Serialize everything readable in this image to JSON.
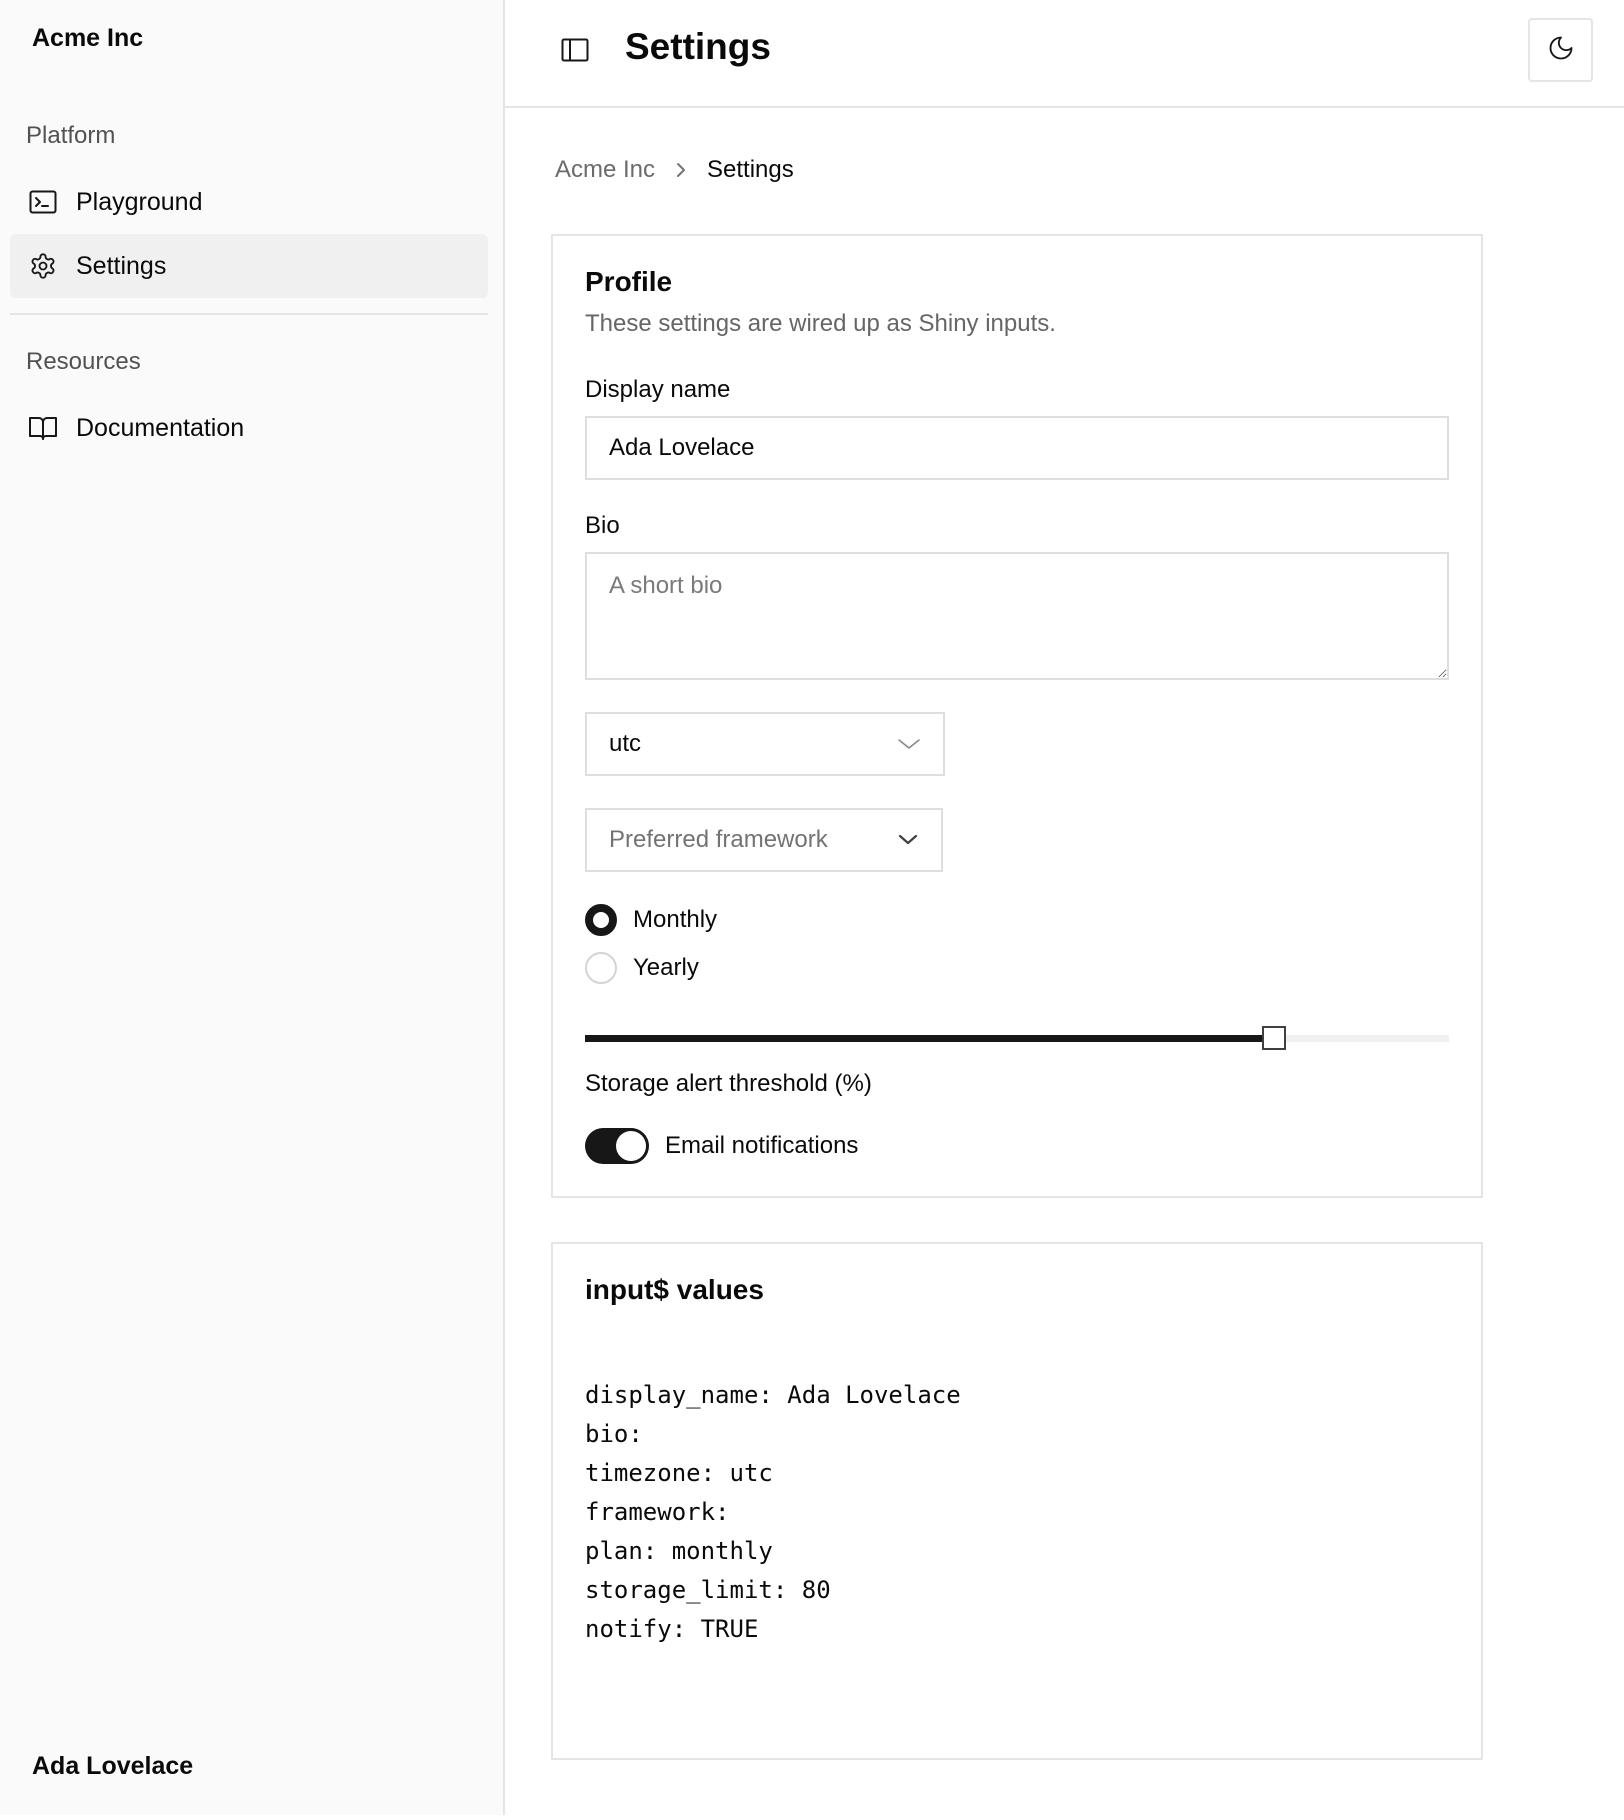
{
  "sidebar": {
    "brand": "Acme Inc",
    "groups": [
      {
        "label": "Platform",
        "items": [
          {
            "label": "Playground",
            "icon": "terminal-icon",
            "active": false
          },
          {
            "label": "Settings",
            "icon": "gear-icon",
            "active": true
          }
        ]
      },
      {
        "label": "Resources",
        "items": [
          {
            "label": "Documentation",
            "icon": "book-icon",
            "active": false
          }
        ]
      }
    ],
    "user": "Ada Lovelace"
  },
  "header": {
    "title": "Settings",
    "toggle_icon": "panel-left-icon",
    "theme_icon": "moon-icon"
  },
  "breadcrumb": {
    "items": [
      "Acme Inc",
      "Settings"
    ]
  },
  "profile": {
    "title": "Profile",
    "description": "These settings are wired up as Shiny inputs.",
    "display_name_label": "Display name",
    "display_name_value": "Ada Lovelace",
    "bio_label": "Bio",
    "bio_value": "",
    "bio_placeholder": "A short bio",
    "timezone_value": "utc",
    "framework_placeholder": "Preferred framework",
    "plan_options": [
      {
        "label": "Monthly",
        "checked": true
      },
      {
        "label": "Yearly",
        "checked": false
      }
    ],
    "storage_value": 80,
    "storage_max": 100,
    "storage_label": "Storage alert threshold (%)",
    "notify_on": true,
    "notify_label": "Email notifications"
  },
  "values_card": {
    "title": "input$ values",
    "lines": [
      "display_name: Ada Lovelace",
      "bio: ",
      "timezone: utc",
      "framework: ",
      "plan: monthly",
      "storage_limit: 80",
      "notify: TRUE"
    ]
  },
  "colors": {
    "accent": "#171717",
    "border": "#e5e5e5",
    "sidebar_bg": "#fafafa",
    "active_bg": "#f0f0f0",
    "muted_text": "#6b6b6b"
  }
}
